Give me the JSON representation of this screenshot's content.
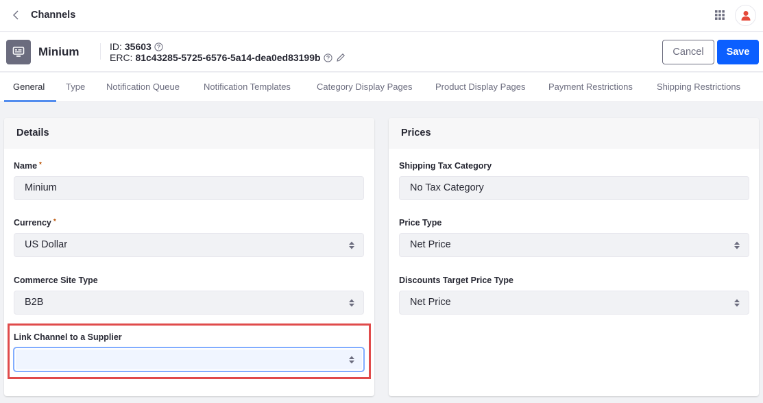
{
  "topbar": {
    "back_icon": "chevron-left-icon",
    "title": "Channels",
    "apps_icon": "apps-grid-icon",
    "avatar_icon": "user-icon"
  },
  "header": {
    "entity_icon": "channel-icon",
    "entity_name": "Minium",
    "id_label": "ID:",
    "id_value": "35603",
    "erc_label": "ERC:",
    "erc_value": "81c43285-5725-6576-5a14-dea0ed83199b",
    "cancel_label": "Cancel",
    "save_label": "Save"
  },
  "tabs": [
    {
      "label": "General",
      "active": true
    },
    {
      "label": "Type"
    },
    {
      "label": "Notification Queue"
    },
    {
      "label": "Notification Templates"
    },
    {
      "label": "Category Display Pages"
    },
    {
      "label": "Product Display Pages"
    },
    {
      "label": "Payment Restrictions"
    },
    {
      "label": "Shipping Restrictions"
    }
  ],
  "details": {
    "title": "Details",
    "required_mark": "*",
    "fields": [
      {
        "label": "Name",
        "value": "Minium",
        "required": true,
        "type": "text"
      },
      {
        "label": "Currency",
        "value": "US Dollar",
        "required": true,
        "type": "select"
      },
      {
        "label": "Commerce Site Type",
        "value": "B2B",
        "type": "select"
      },
      {
        "label": "Link Channel to a Supplier",
        "value": "",
        "type": "select",
        "focused": true,
        "highlighted": true
      }
    ]
  },
  "prices": {
    "title": "Prices",
    "fields": [
      {
        "label": "Shipping Tax Category",
        "value": "No Tax Category",
        "type": "text"
      },
      {
        "label": "Price Type",
        "value": "Net Price",
        "type": "select"
      },
      {
        "label": "Discounts Target Price Type",
        "value": "Net Price",
        "type": "select"
      }
    ]
  },
  "colors": {
    "primary": "#0b5fff",
    "tab_active_underline": "#528cee",
    "highlight_border": "#e04b4b",
    "required": "#b95000"
  }
}
